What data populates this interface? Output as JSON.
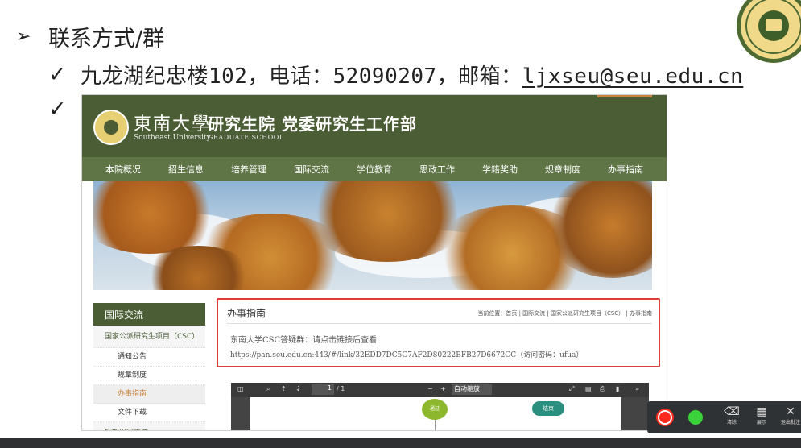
{
  "slide": {
    "heading": "联系方式/群",
    "arrow_glyph": "➢",
    "check_glyph": "✓",
    "contact_prefix": "九龙湖纪忠楼102，电话：52090207，邮箱：",
    "contact_email": "ljxseu@seu.edu.cn"
  },
  "site": {
    "univ_cn": "東南大學",
    "univ_en": "Southeast University",
    "school_cn": "研究生院  党委研究生工作部",
    "school_en": "GRADUATE SCHOOL",
    "nav": [
      "本院概况",
      "招生信息",
      "培养管理",
      "国际交流",
      "学位教育",
      "思政工作",
      "学籍奖助",
      "规章制度",
      "办事指南"
    ],
    "sidebar": {
      "title": "国际交流",
      "parent": "国家公派研究生项目（CSC）",
      "items": [
        "通知公告",
        "规章制度",
        "办事指南",
        "文件下载"
      ],
      "active_index": 2,
      "next_parent": "短期出国交流"
    },
    "content": {
      "title": "办事指南",
      "breadcrumb": "当前位置：首页 | 国际交流 | 国家公派研究生项目（CSC） | 办事指南",
      "csc_line": "东南大学CSC答疑群：请点击链接后查看",
      "csc_link": "https://pan.seu.edu.cn:443/#/link/32EDD7DC5C7AF2D80222BFB27D6672CC（访问密码：ufua）"
    },
    "pdf": {
      "page_current": "1",
      "page_total": "/ 1",
      "zoom": "自动缩放",
      "node_start": "通过",
      "node_end": "结束"
    }
  },
  "recorder": {
    "tools": [
      {
        "icon": "eraser-icon",
        "label": "清除"
      },
      {
        "icon": "grid-icon",
        "label": "展示"
      },
      {
        "icon": "close-icon",
        "label": "退出批注"
      }
    ]
  },
  "colors": {
    "site_green": "#4b5d35",
    "nav_green": "#5f7546",
    "highlight_red": "#e03c3c",
    "record_red": "#ff2a1f",
    "record_green": "#3ad13a"
  }
}
